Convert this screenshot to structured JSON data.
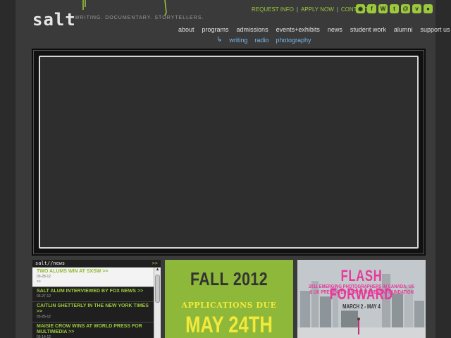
{
  "header": {
    "logo": "salt",
    "tagline": "WRITING. DOCUMENTARY. STORYTELLERS.",
    "util_links": [
      "REQUEST INFO",
      "APPLY NOW",
      "CONTACT"
    ],
    "social_icons": [
      "rss-icon",
      "facebook-icon",
      "wordpress-icon",
      "twitter-icon",
      "email-icon",
      "vimeo-icon",
      "flickr-icon"
    ]
  },
  "main_nav": [
    "about",
    "programs",
    "admissions",
    "events+exhibits",
    "news",
    "student work",
    "alumni",
    "support us"
  ],
  "sub_nav": [
    "writing",
    "radio",
    "photography"
  ],
  "news": {
    "heading": "salt//news",
    "more": ">>",
    "items": [
      {
        "title": "TWO ALUMS WIN AT SXSW >>",
        "date": "03-28-12"
      },
      {
        "title": "SALT ALUM INTERVIEWED BY FOX NEWS >>",
        "date": "03-27-12"
      },
      {
        "title": "CAITLIN SHETTERLY IN THE NEW YORK TIMES >>",
        "date": "03-26-12"
      },
      {
        "title": "MAISIE CROW WINS AT WORLD PRESS FOR MULTIMEDIA >>",
        "date": "03-14-12"
      }
    ]
  },
  "promo_fall": {
    "line1": "FALL 2012",
    "line2": "APPLICATIONS DUE",
    "line3": "MAY 24TH"
  },
  "promo_flash": {
    "title": "FLASH FORWARD",
    "subtitle_1": "2011 EMERGING PHOTOGRAPHERS IN CANADA, US",
    "subtitle_2": "& UK PRESENTED BY THE MAGENTA FOUNDATION",
    "dates": "MARCH 2 - MAY 4"
  },
  "colors": {
    "accent_green": "#9cc93b",
    "link_blue": "#76b7e6",
    "promo_yellow": "#f2e93a",
    "promo_pink": "#e8389b"
  }
}
